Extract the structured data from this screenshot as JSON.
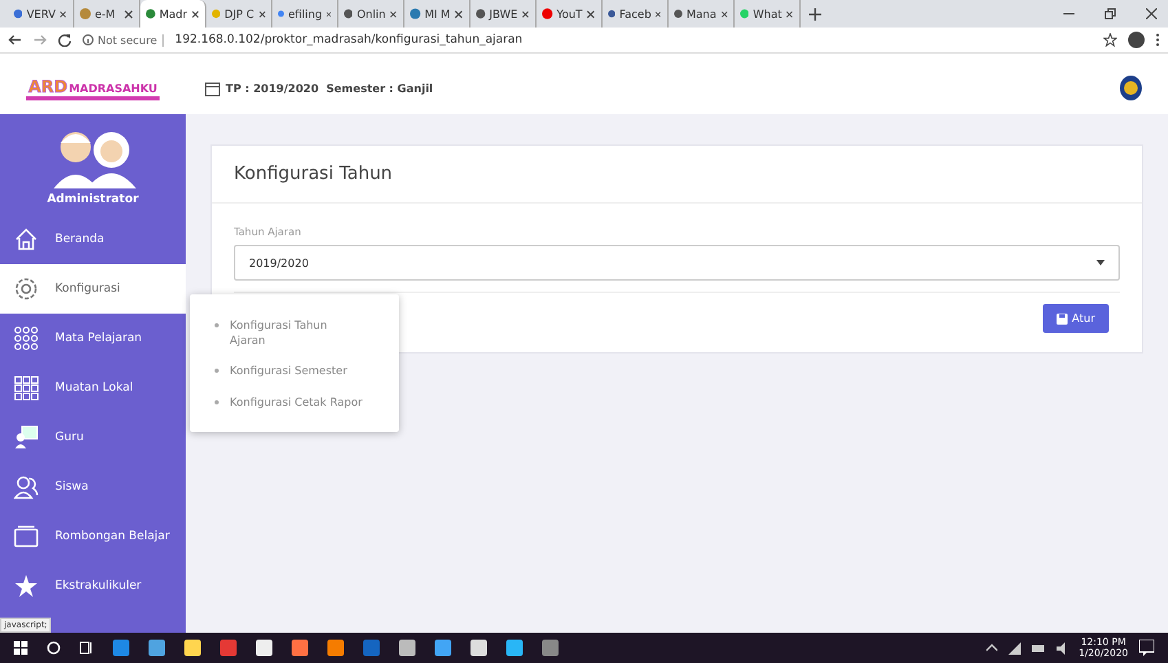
{
  "browser": {
    "tabs": [
      {
        "title": "VERV",
        "selected": false
      },
      {
        "title": "e-M",
        "selected": false
      },
      {
        "title": "Madr",
        "selected": true
      },
      {
        "title": "DJP C",
        "selected": false
      },
      {
        "title": "efiling",
        "selected": false
      },
      {
        "title": "Onlin",
        "selected": false
      },
      {
        "title": "MI M",
        "selected": false
      },
      {
        "title": "JBWE",
        "selected": false
      },
      {
        "title": "YouT",
        "selected": false
      },
      {
        "title": "Faceb",
        "selected": false
      },
      {
        "title": "Mana",
        "selected": false
      },
      {
        "title": "What",
        "selected": false
      }
    ],
    "security": "Not secure",
    "url": "192.168.0.102/proktor_madrasah/konfigurasi_tahun_ajaran"
  },
  "header": {
    "logo_main": "ARD",
    "logo_sub": "MADRASAHKU",
    "session": "TP : 2019/2020  Semester : Ganjil"
  },
  "sidebar": {
    "user": "Administrator",
    "items": [
      {
        "label": "Beranda",
        "kind": "home",
        "selected": false
      },
      {
        "label": "Konfigurasi",
        "kind": "gear",
        "selected": true
      },
      {
        "label": "Mata Pelajaran",
        "kind": "dots",
        "selected": false
      },
      {
        "label": "Muatan Lokal",
        "kind": "grid",
        "selected": false
      },
      {
        "label": "Guru",
        "kind": "teacher",
        "selected": false
      },
      {
        "label": "Siswa",
        "kind": "users",
        "selected": false
      },
      {
        "label": "Rombongan Belajar",
        "kind": "folder",
        "selected": false
      },
      {
        "label": "Ekstrakulikuler",
        "kind": "star",
        "selected": false
      }
    ]
  },
  "submenu": [
    "Konfigurasi Tahun Ajaran",
    "Konfigurasi Semester",
    "Konfigurasi Cetak Rapor"
  ],
  "card": {
    "title": "Konfigurasi Tahun",
    "field_label": "Tahun Ajaran",
    "field_value": "2019/2020",
    "button": "Atur"
  },
  "status_link": "javascript;",
  "taskbar": {
    "time": "12:10 PM",
    "date": "1/20/2020"
  }
}
